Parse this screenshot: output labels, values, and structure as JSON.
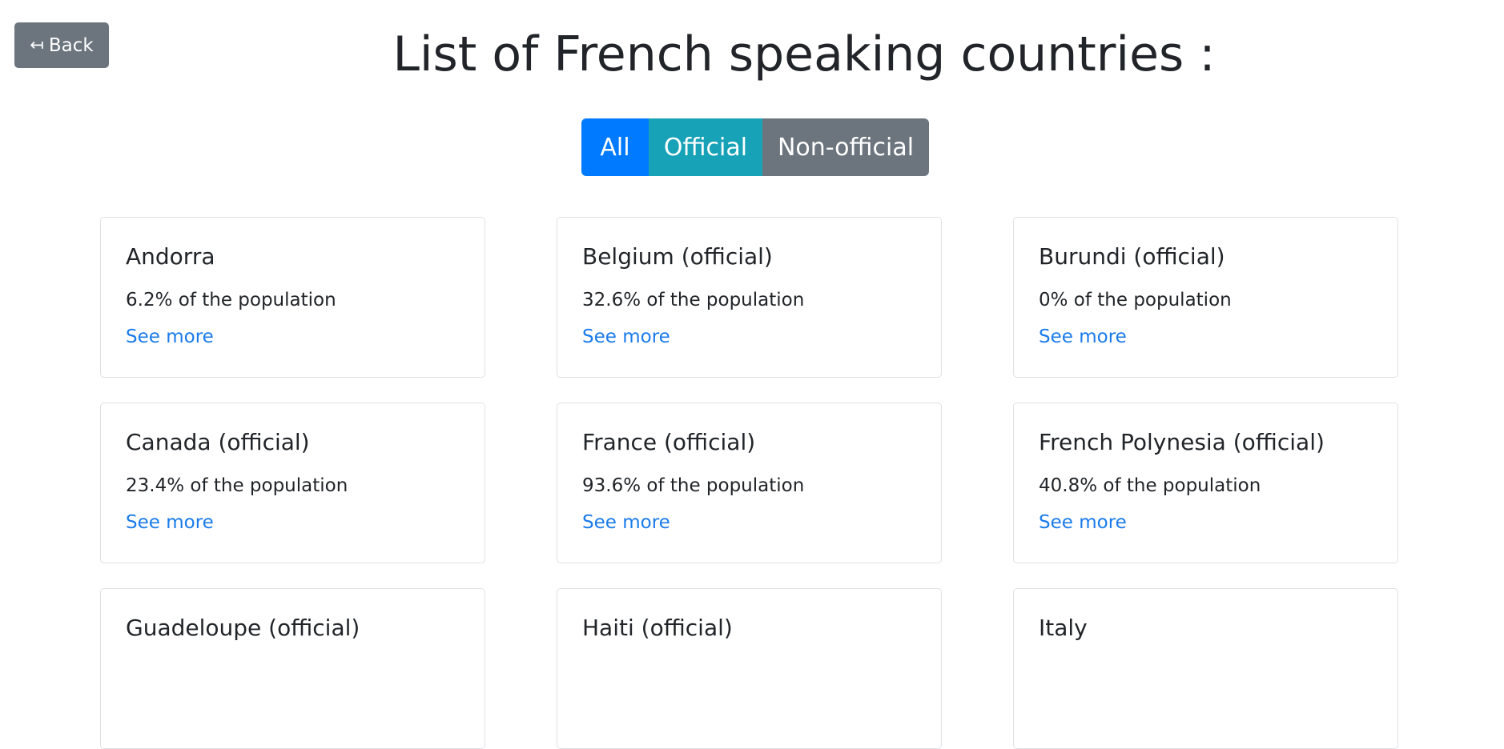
{
  "back_button": {
    "icon": "back-arrow-icon",
    "icon_glyph": "↤",
    "label": "Back"
  },
  "page_title": "List of French speaking countries :",
  "filters": [
    {
      "label": "All",
      "color": "#007bff",
      "active": true
    },
    {
      "label": "Official",
      "color": "#17a2b8",
      "active": false
    },
    {
      "label": "Non-official",
      "color": "#6c757d",
      "active": false
    }
  ],
  "link_color": "#1a7bea",
  "countries": [
    {
      "title": "Andorra",
      "population": "6.2% of the population",
      "link": "See more"
    },
    {
      "title": "Belgium (official)",
      "population": "32.6% of the population",
      "link": "See more"
    },
    {
      "title": "Burundi (official)",
      "population": "0% of the population",
      "link": "See more"
    },
    {
      "title": "Canada (official)",
      "population": "23.4% of the population",
      "link": "See more"
    },
    {
      "title": "France (official)",
      "population": "93.6% of the population",
      "link": "See more"
    },
    {
      "title": "French Polynesia (official)",
      "population": "40.8% of the population",
      "link": "See more"
    },
    {
      "title": "Guadeloupe (official)",
      "population": "",
      "link": ""
    },
    {
      "title": "Haiti (official)",
      "population": "",
      "link": ""
    },
    {
      "title": "Italy",
      "population": "",
      "link": ""
    }
  ]
}
